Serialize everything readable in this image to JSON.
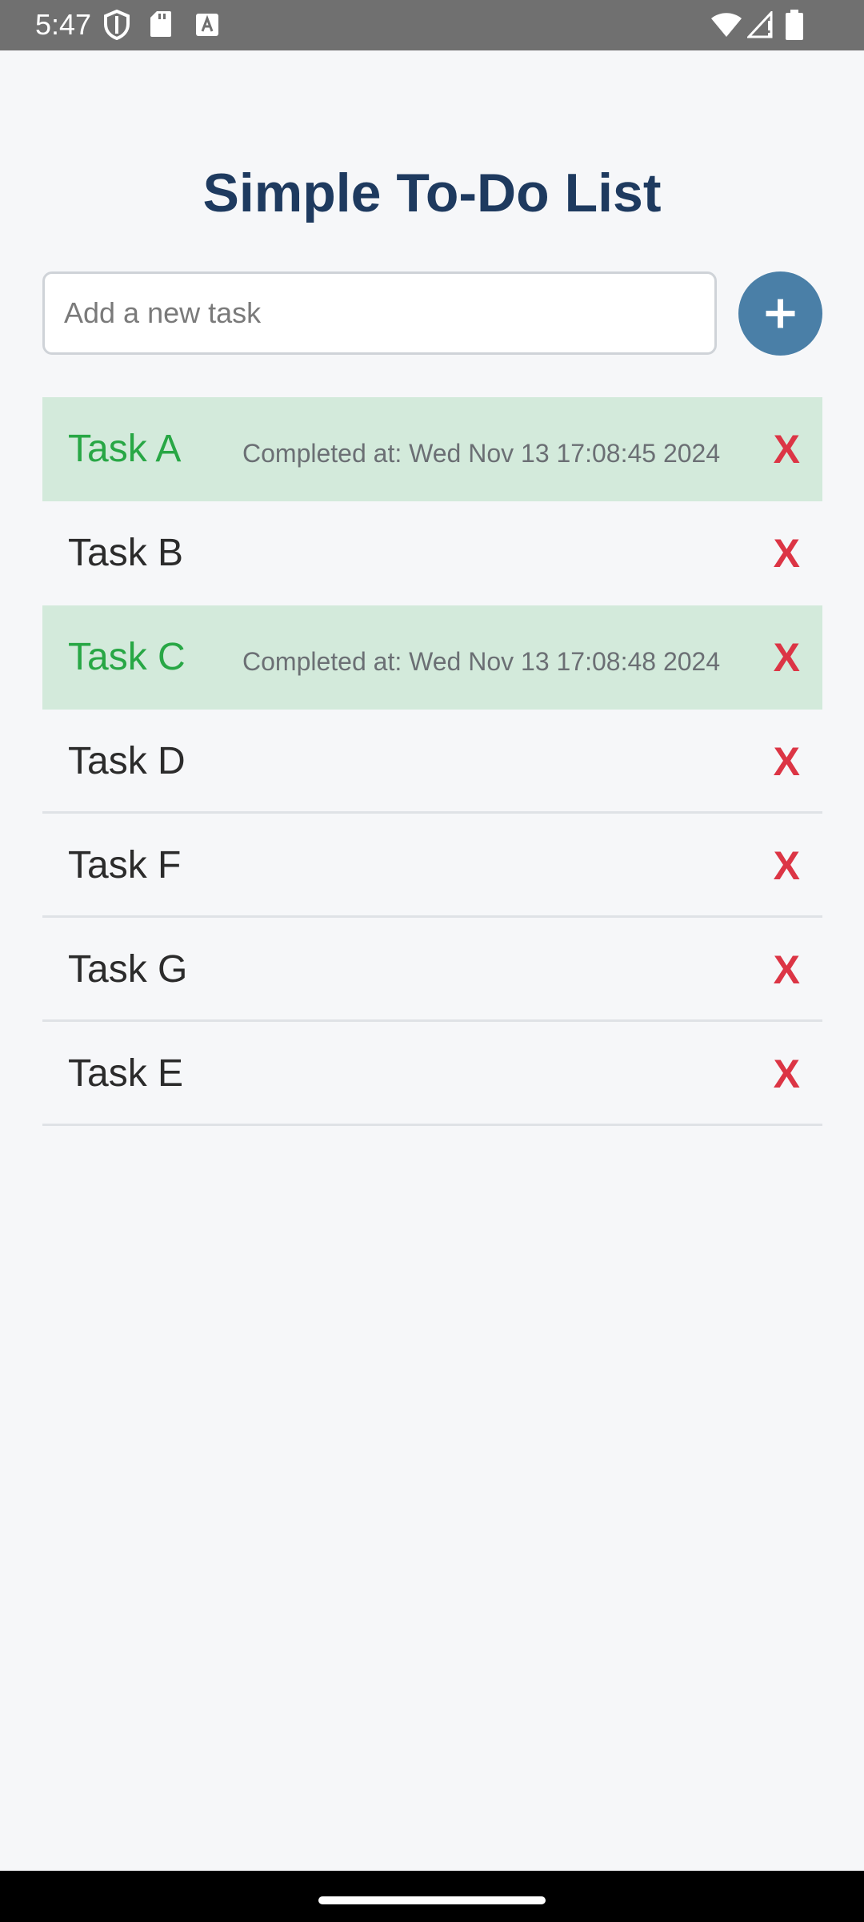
{
  "status_bar": {
    "time": "5:47",
    "icons_left": [
      "shield-icon",
      "sd-card-icon",
      "keyboard-a-icon"
    ],
    "icons_right": [
      "wifi-icon",
      "signal-icon",
      "battery-icon"
    ]
  },
  "app": {
    "title": "Simple To-Do List"
  },
  "input": {
    "placeholder": "Add a new task",
    "value": "",
    "add_button_label": "+"
  },
  "tasks": [
    {
      "name": "Task A",
      "completed": true,
      "completed_at": "Completed at: Wed Nov 13 17:08:45 2024",
      "delete_label": "X"
    },
    {
      "name": "Task B",
      "completed": false,
      "completed_at": "",
      "delete_label": "X"
    },
    {
      "name": "Task C",
      "completed": true,
      "completed_at": "Completed at: Wed Nov 13 17:08:48 2024",
      "delete_label": "X"
    },
    {
      "name": "Task D",
      "completed": false,
      "completed_at": "",
      "delete_label": "X"
    },
    {
      "name": "Task F",
      "completed": false,
      "completed_at": "",
      "delete_label": "X"
    },
    {
      "name": "Task G",
      "completed": false,
      "completed_at": "",
      "delete_label": "X"
    },
    {
      "name": "Task E",
      "completed": false,
      "completed_at": "",
      "delete_label": "X"
    }
  ],
  "colors": {
    "title": "#1e3a5f",
    "add_button": "#4a7fa7",
    "completed_bg": "#d3eadb",
    "completed_text": "#28a745",
    "delete": "#dc3545"
  }
}
